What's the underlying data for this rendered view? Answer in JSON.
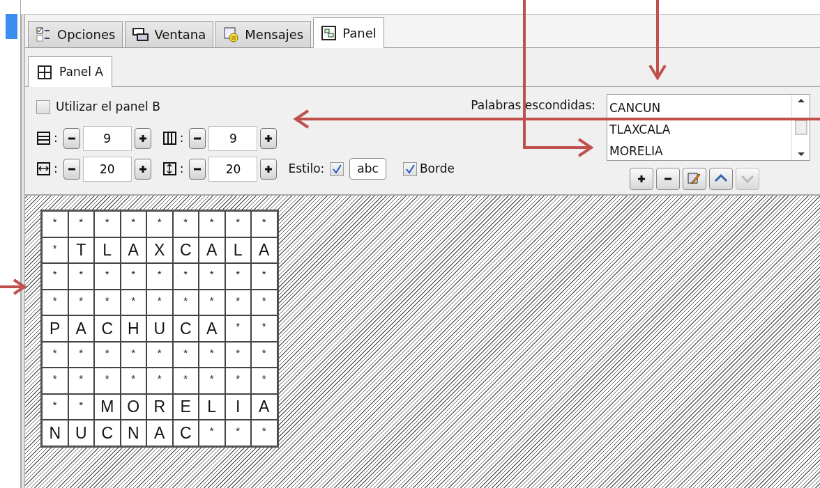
{
  "tabs": [
    {
      "label": "Opciones",
      "kind": "options",
      "selected": false
    },
    {
      "label": "Ventana",
      "kind": "window",
      "selected": false
    },
    {
      "label": "Mensajes",
      "kind": "messages",
      "selected": false
    },
    {
      "label": "Panel",
      "kind": "panel",
      "selected": true
    }
  ],
  "subtabs": [
    {
      "label": "Panel A",
      "selected": true
    }
  ],
  "use_panel_b": {
    "label": "Utilizar el panel B",
    "checked": false
  },
  "spinners": [
    {
      "kind": "rows",
      "label": ":",
      "value": "9"
    },
    {
      "kind": "columns",
      "label": ":",
      "value": "9"
    },
    {
      "kind": "width",
      "label": ":",
      "value": "20"
    },
    {
      "kind": "height",
      "label": ":",
      "value": "20"
    }
  ],
  "style": {
    "label": "Estilo:",
    "checked": true,
    "sample": "abc"
  },
  "border": {
    "label": "Borde",
    "checked": true
  },
  "hidden_words": {
    "label": "Palabras escondidas:",
    "items": [
      {
        "text": "CANCUN",
        "selected": false
      },
      {
        "text": "TLAXCALA",
        "selected": false
      },
      {
        "text": "MORELIA",
        "selected": false
      }
    ],
    "buttons": [
      {
        "kind": "add",
        "disabled": false
      },
      {
        "kind": "remove",
        "disabled": false
      },
      {
        "kind": "edit",
        "disabled": false
      },
      {
        "kind": "up",
        "disabled": false
      },
      {
        "kind": "down",
        "disabled": true
      }
    ]
  },
  "grid": [
    [
      "*",
      "*",
      "*",
      "*",
      "*",
      "*",
      "*",
      "*",
      "*"
    ],
    [
      "*",
      "T",
      "L",
      "A",
      "X",
      "C",
      "A",
      "L",
      "A"
    ],
    [
      "*",
      "*",
      "*",
      "*",
      "*",
      "*",
      "*",
      "*",
      "*"
    ],
    [
      "*",
      "*",
      "*",
      "*",
      "*",
      "*",
      "*",
      "*",
      "*"
    ],
    [
      "P",
      "A",
      "C",
      "H",
      "U",
      "C",
      "A",
      "*",
      "*"
    ],
    [
      "*",
      "*",
      "*",
      "*",
      "*",
      "*",
      "*",
      "*",
      "*"
    ],
    [
      "*",
      "*",
      "*",
      "*",
      "*",
      "*",
      "*",
      "*",
      "*"
    ],
    [
      "*",
      "*",
      "M",
      "O",
      "R",
      "E",
      "L",
      "I",
      "A"
    ],
    [
      "N",
      "U",
      "C",
      "N",
      "A",
      "C",
      "*",
      "*",
      "*"
    ]
  ]
}
